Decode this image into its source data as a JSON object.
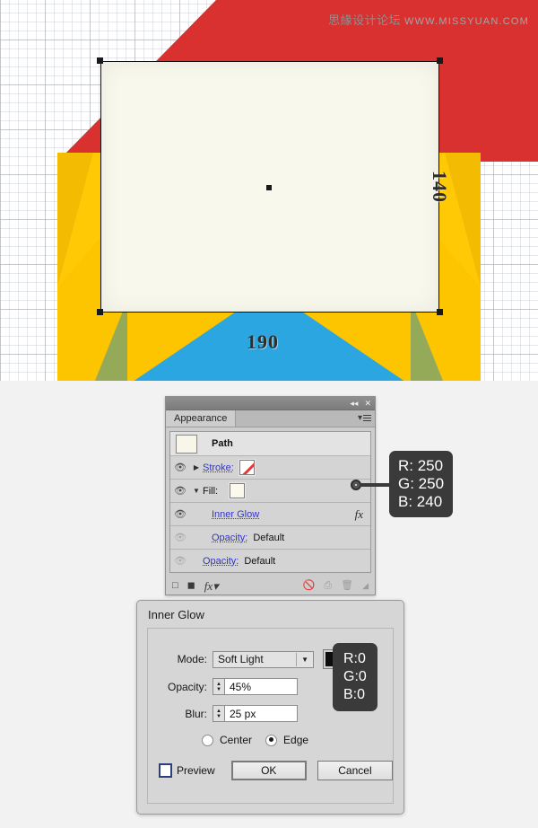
{
  "canvas": {
    "watermark_cn": "思緣设计论坛",
    "watermark_url": "WWW.MISSYUAN.COM",
    "dimension_width": "190",
    "dimension_height": "140",
    "colors": {
      "envelope_body": "#fdc400",
      "flap_red": "#d93030",
      "bottom_blue": "#2ba6e0",
      "letter_fill": "#f9f8ed",
      "grid_line": "#aaacb4"
    }
  },
  "appearance_panel": {
    "titlebar": {
      "collapse_icon": "collapse-icon",
      "close_icon": "close-icon"
    },
    "tab_label": "Appearance",
    "menu_icon": "panel-menu-icon",
    "rows": [
      {
        "label": "Path",
        "type": "header",
        "thumb": "path-thumbnail"
      },
      {
        "label": "Stroke:",
        "type": "attribute",
        "swatch": "none-stroke-swatch",
        "disclosure": "collapsed"
      },
      {
        "label": "Fill:",
        "type": "attribute",
        "swatch": "fill-color-swatch",
        "disclosure": "expanded"
      },
      {
        "label": "Inner Glow",
        "type": "effect",
        "fx": "fx"
      },
      {
        "label": "Opacity:",
        "value": "Default",
        "type": "opacity-nested"
      },
      {
        "label": "Opacity:",
        "value": "Default",
        "type": "opacity"
      }
    ],
    "footer_icons": [
      "add-new-stroke-icon",
      "add-new-fill-icon",
      "add-new-effect-icon",
      "clear-appearance-icon",
      "duplicate-item-icon",
      "delete-item-icon",
      "resize-grip-icon"
    ]
  },
  "fill_callout": {
    "r": "R: 250",
    "g": "G: 250",
    "b": "B: 240"
  },
  "dialog": {
    "title": "Inner Glow",
    "mode_label": "Mode:",
    "mode_value": "Soft Light",
    "color_swatch": "glow-color-swatch",
    "opacity_label": "Opacity:",
    "opacity_value": "45%",
    "blur_label": "Blur:",
    "blur_value": "25 px",
    "radio_center": "Center",
    "radio_edge": "Edge",
    "selected_radio": "Edge",
    "preview_label": "Preview",
    "preview_checked": false,
    "ok_label": "OK",
    "cancel_label": "Cancel"
  },
  "glow_callout": {
    "r": "R:0",
    "g": "G:0",
    "b": "B:0"
  }
}
